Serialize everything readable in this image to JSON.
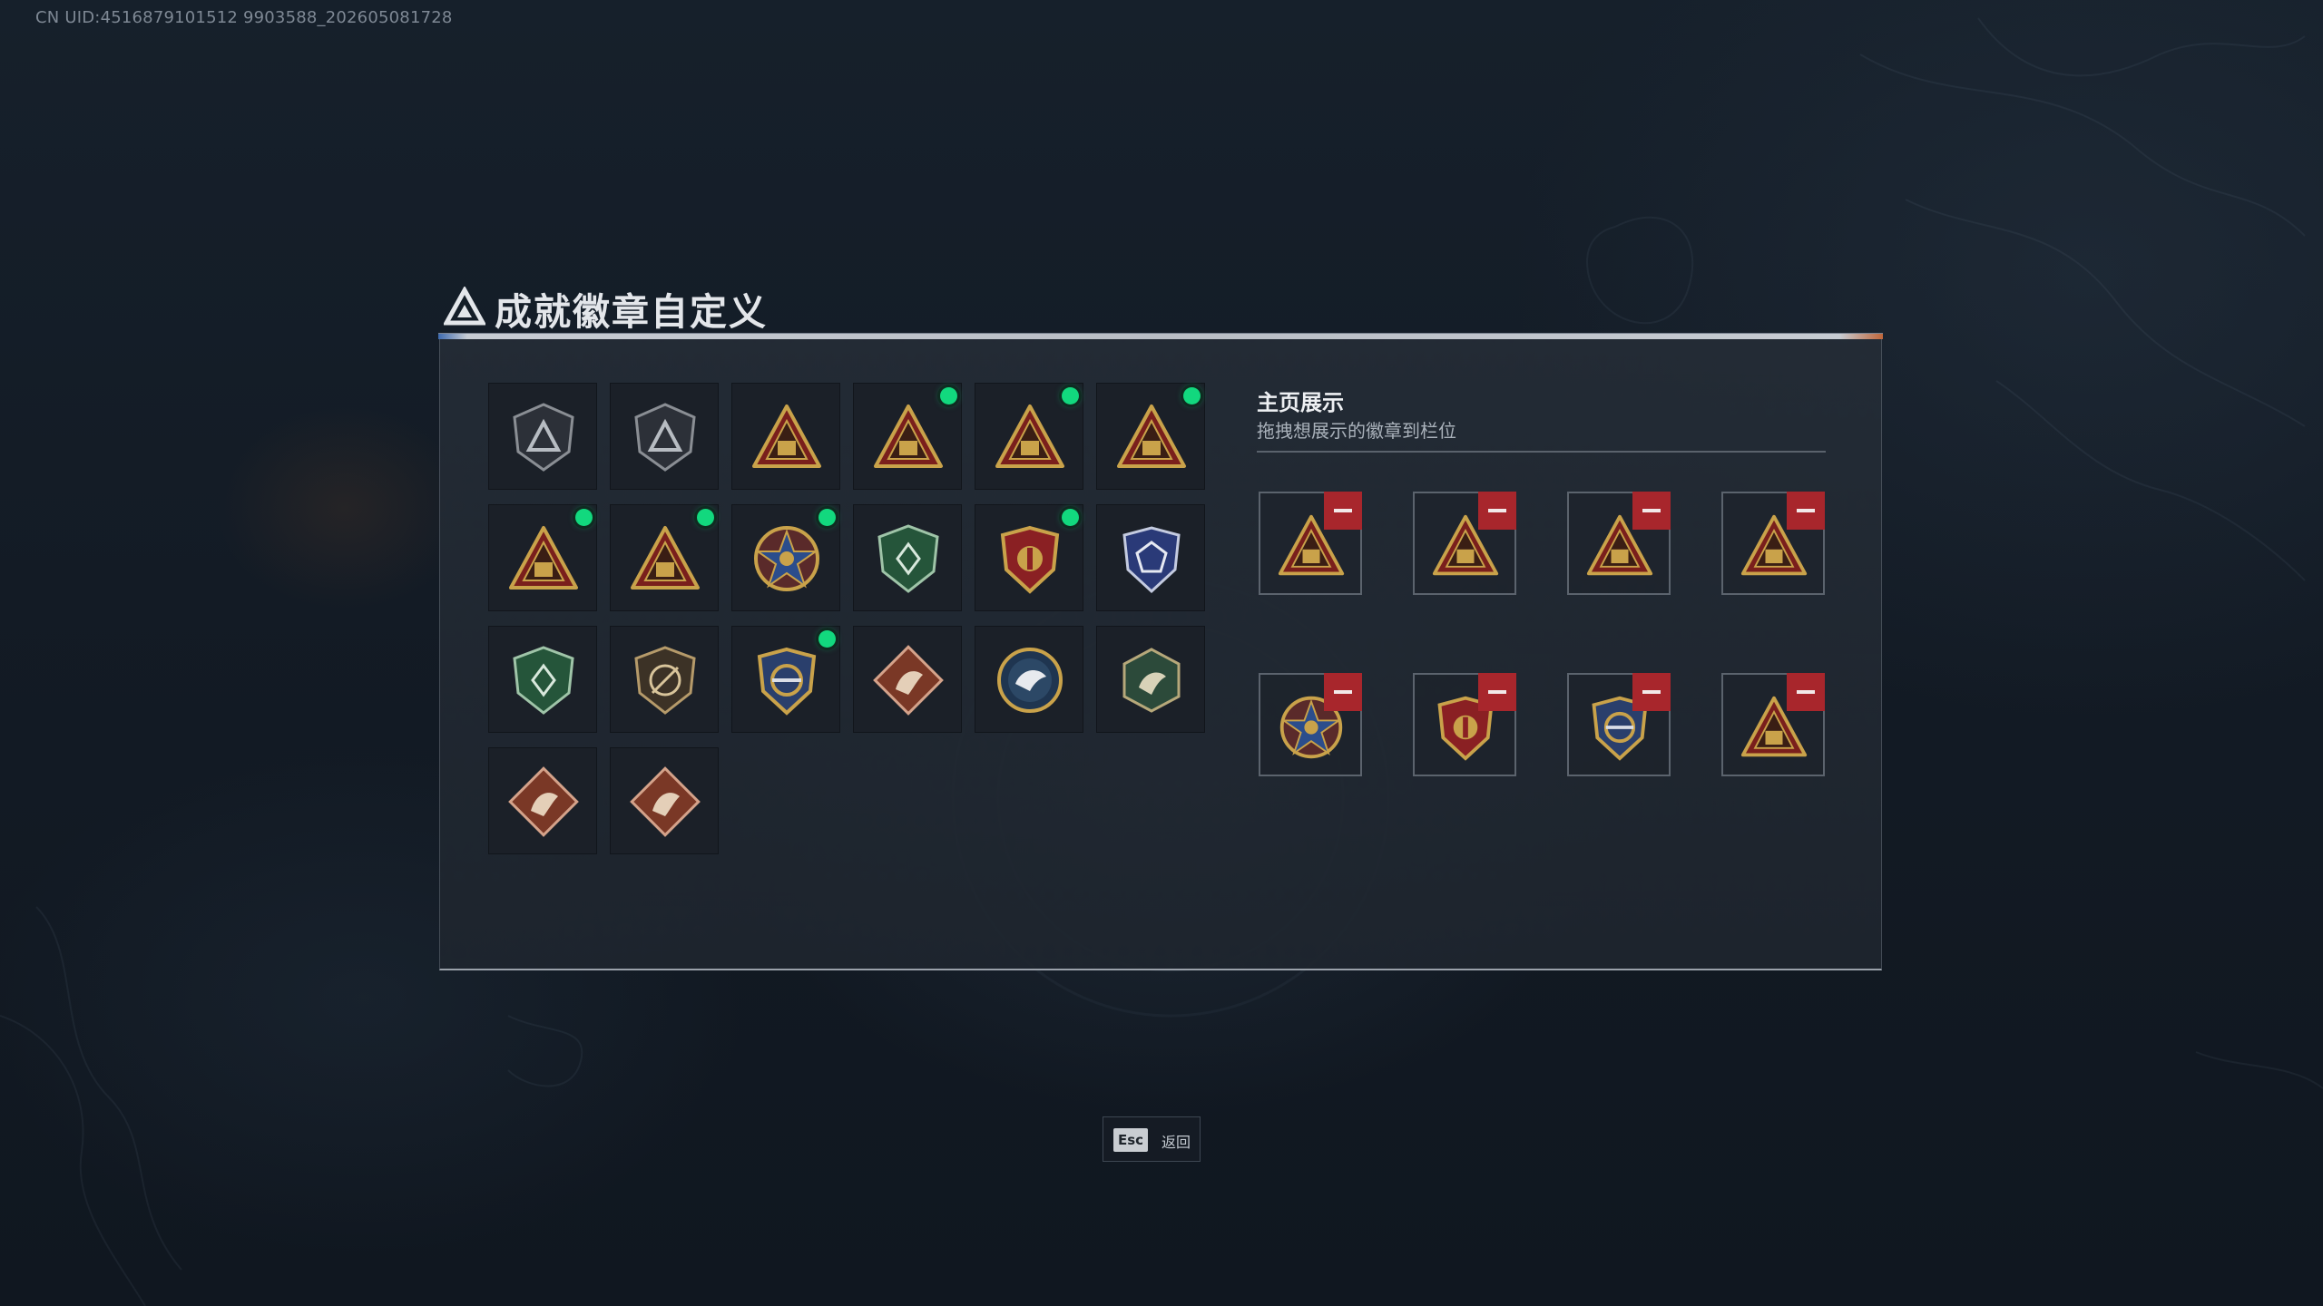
{
  "uid_text": "CN UID:4516879101512 9903588_202605081728",
  "header": {
    "title": "成就徽章自定义"
  },
  "badges": [
    {
      "name": "triangle-shield-badge",
      "dot": false,
      "style": "gray"
    },
    {
      "name": "helicopter-shield-badge",
      "dot": false,
      "style": "gray"
    },
    {
      "name": "s6-triangle-badge",
      "dot": false,
      "style": "gold"
    },
    {
      "name": "building-triangle-badge",
      "dot": true,
      "style": "gold"
    },
    {
      "name": "number-one-triangle-badge",
      "dot": true,
      "style": "gold"
    },
    {
      "name": "hands-triangle-badge",
      "dot": true,
      "style": "gold"
    },
    {
      "name": "soldiers-triangle-badge",
      "dot": true,
      "style": "gold"
    },
    {
      "name": "rocket-triangle-badge",
      "dot": true,
      "style": "gold"
    },
    {
      "name": "star-medal-badge",
      "dot": true,
      "style": "star"
    },
    {
      "name": "green-shield-badge",
      "dot": false,
      "style": "green"
    },
    {
      "name": "red-crest-badge",
      "dot": true,
      "style": "crest"
    },
    {
      "name": "blue-shield-badge",
      "dot": false,
      "style": "blue"
    },
    {
      "name": "green-rifle-shield-badge",
      "dot": false,
      "style": "green"
    },
    {
      "name": "rifle-shield-badge",
      "dot": false,
      "style": "brown"
    },
    {
      "name": "blue-gold-crest-badge",
      "dot": true,
      "style": "crest2"
    },
    {
      "name": "wolf-diamond-badge",
      "dot": false,
      "style": "diamond"
    },
    {
      "name": "eagle-round-badge",
      "dot": false,
      "style": "round"
    },
    {
      "name": "wasp-hexagon-badge",
      "dot": false,
      "style": "hex"
    },
    {
      "name": "dragon-diamond-badge",
      "dot": false,
      "style": "diamond"
    },
    {
      "name": "runner-diamond-badge",
      "dot": false,
      "style": "diamond"
    }
  ],
  "showcase": {
    "title": "主页展示",
    "subtitle": "拖拽想展示的徽章到栏位",
    "slots": [
      {
        "badge": "hands-triangle-badge",
        "style": "gold"
      },
      {
        "badge": "building-triangle-badge",
        "style": "gold"
      },
      {
        "badge": "number-one-triangle-badge",
        "style": "gold"
      },
      {
        "badge": "soldiers-triangle-badge",
        "style": "gold"
      },
      {
        "badge": "star-medal-badge",
        "style": "star"
      },
      {
        "badge": "red-crest-badge",
        "style": "crest"
      },
      {
        "badge": "blue-gold-crest-badge",
        "style": "crest2"
      },
      {
        "badge": "rocket-triangle-badge",
        "style": "gold"
      }
    ]
  },
  "footer": {
    "esc_key": "Esc",
    "back_label": "返回"
  },
  "colors": {
    "accent_green": "#12d87e",
    "remove_red": "#a8262c",
    "gold": "#c9a24a"
  }
}
